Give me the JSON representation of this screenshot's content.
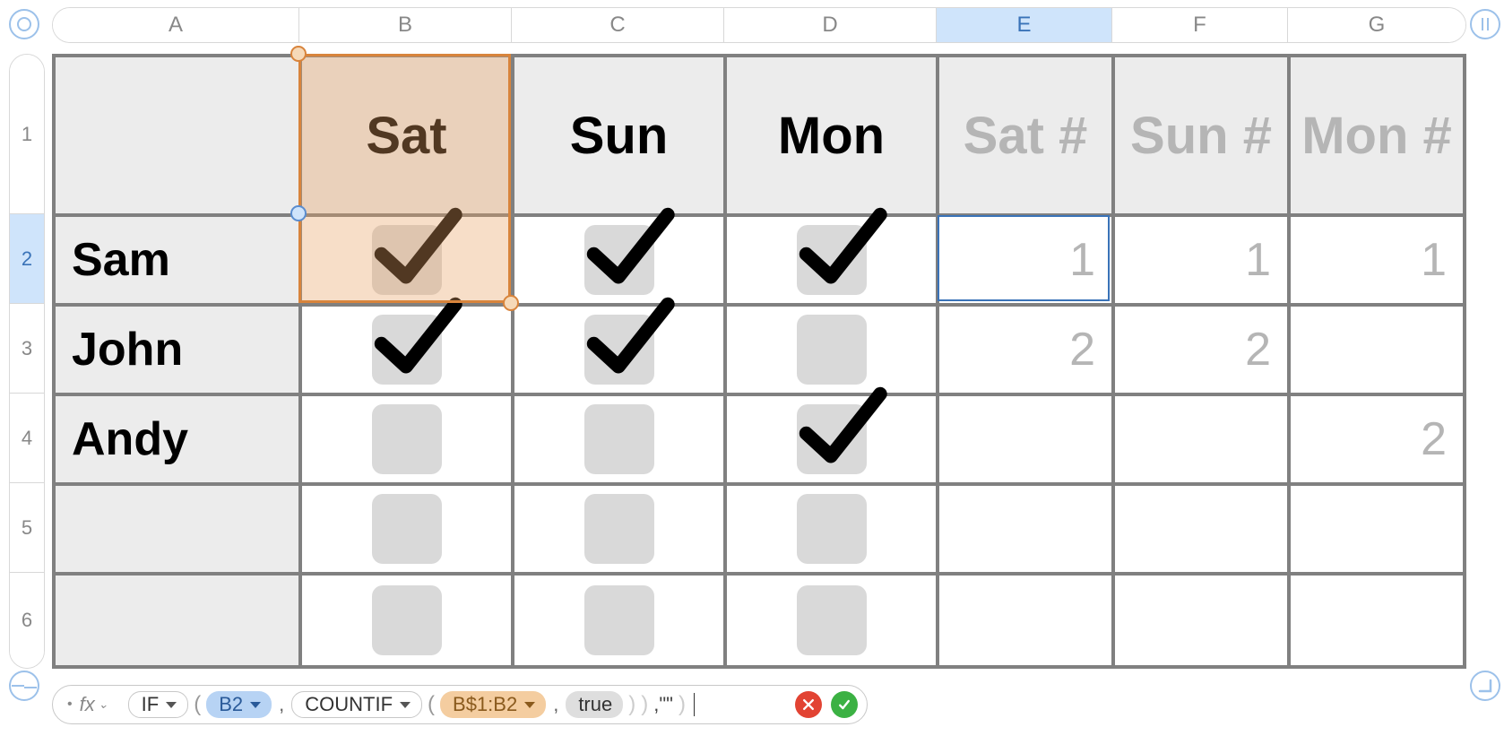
{
  "columns": [
    "A",
    "B",
    "C",
    "D",
    "E",
    "F",
    "G"
  ],
  "rows": [
    "1",
    "2",
    "3",
    "4",
    "5",
    "6"
  ],
  "selected_column": "E",
  "selected_row": "2",
  "header_row": {
    "A": "",
    "B": "Sat",
    "C": "Sun",
    "D": "Mon",
    "E": "Sat #",
    "F": "Sun #",
    "G": "Mon #"
  },
  "data_rows": [
    {
      "name": "Sam",
      "checks": [
        true,
        true,
        true
      ],
      "nums": [
        "1",
        "1",
        "1"
      ]
    },
    {
      "name": "John",
      "checks": [
        true,
        true,
        false
      ],
      "nums": [
        "2",
        "2",
        ""
      ]
    },
    {
      "name": "Andy",
      "checks": [
        false,
        false,
        true
      ],
      "nums": [
        "",
        "",
        "2"
      ]
    },
    {
      "name": "",
      "checks": [
        false,
        false,
        false
      ],
      "nums": [
        "",
        "",
        ""
      ]
    },
    {
      "name": "",
      "checks": [
        false,
        false,
        false
      ],
      "nums": [
        "",
        "",
        ""
      ]
    }
  ],
  "highlight_range": "B1:B2",
  "active_cell": "E2",
  "formula": {
    "fx_label": "fx",
    "fn_outer": "IF",
    "ref1": "B2",
    "fn_inner": "COUNTIF",
    "ref2": "B$1:B2",
    "arg_true": "true",
    "tail": ",\"\""
  },
  "icons": {
    "cancel": "cancel",
    "accept": "accept"
  }
}
